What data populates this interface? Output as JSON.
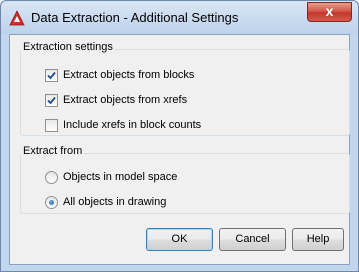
{
  "window": {
    "title": "Data Extraction - Additional Settings",
    "close_label": "x"
  },
  "extraction_settings": {
    "label": "Extraction settings",
    "options": [
      {
        "label": "Extract objects from blocks",
        "checked": true
      },
      {
        "label": "Extract objects from xrefs",
        "checked": true
      },
      {
        "label": "Include xrefs in block counts",
        "checked": false
      }
    ]
  },
  "extract_from": {
    "label": "Extract from",
    "options": [
      {
        "label": "Objects in model space",
        "selected": false
      },
      {
        "label": "All objects in drawing",
        "selected": true
      }
    ]
  },
  "buttons": {
    "ok": "OK",
    "cancel": "Cancel",
    "help": "Help"
  },
  "colors": {
    "titlebar": "#c2d6ee",
    "close": "#c5362b",
    "app_icon": "#d42c2c",
    "client": "#f0f0f0"
  }
}
